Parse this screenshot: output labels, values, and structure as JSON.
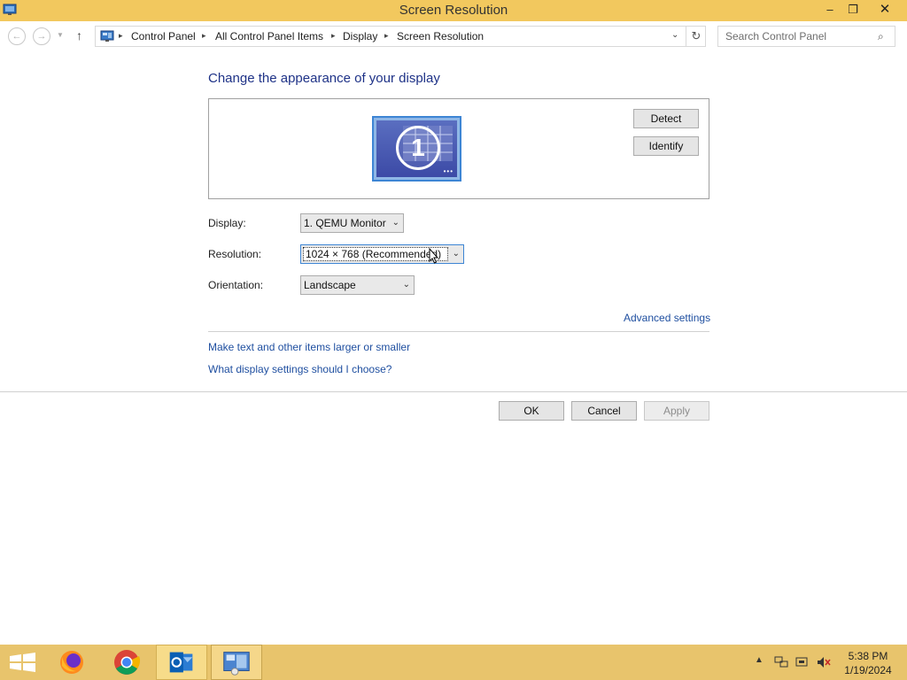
{
  "window": {
    "title": "Screen Resolution",
    "controls": {
      "minimize": "–",
      "maximize": "❐",
      "close": "✕"
    }
  },
  "nav": {
    "back": "←",
    "forward": "→",
    "recent": "▼",
    "up": "↑",
    "breadcrumbs": [
      "Control Panel",
      "All Control Panel Items",
      "Display",
      "Screen Resolution"
    ],
    "separator": "▸",
    "dropdown": "⌄",
    "refresh": "↻",
    "search_placeholder": "Search Control Panel",
    "search_icon": "⌕"
  },
  "main": {
    "heading": "Change the appearance of your display",
    "monitor_number": "1",
    "monitor_dots": "•••",
    "detect_label": "Detect",
    "identify_label": "Identify",
    "display_label": "Display:",
    "display_value": "1. QEMU Monitor",
    "resolution_label": "Resolution:",
    "resolution_value": "1024 × 768 (Recommended)",
    "orientation_label": "Orientation:",
    "orientation_value": "Landscape",
    "select_arrow": "⌄",
    "advanced_link": "Advanced settings",
    "link_text_size": "Make text and other items larger or smaller",
    "link_settings": "What display settings should I choose?",
    "ok_label": "OK",
    "cancel_label": "Cancel",
    "apply_label": "Apply"
  },
  "taskbar": {
    "tray_up": "▲",
    "time": "5:38 PM",
    "date": "1/19/2024"
  },
  "colors": {
    "titlebar": "#f2c85e",
    "taskbar": "#e8c46c",
    "link": "#1f4fa0",
    "heading": "#1e3287"
  }
}
